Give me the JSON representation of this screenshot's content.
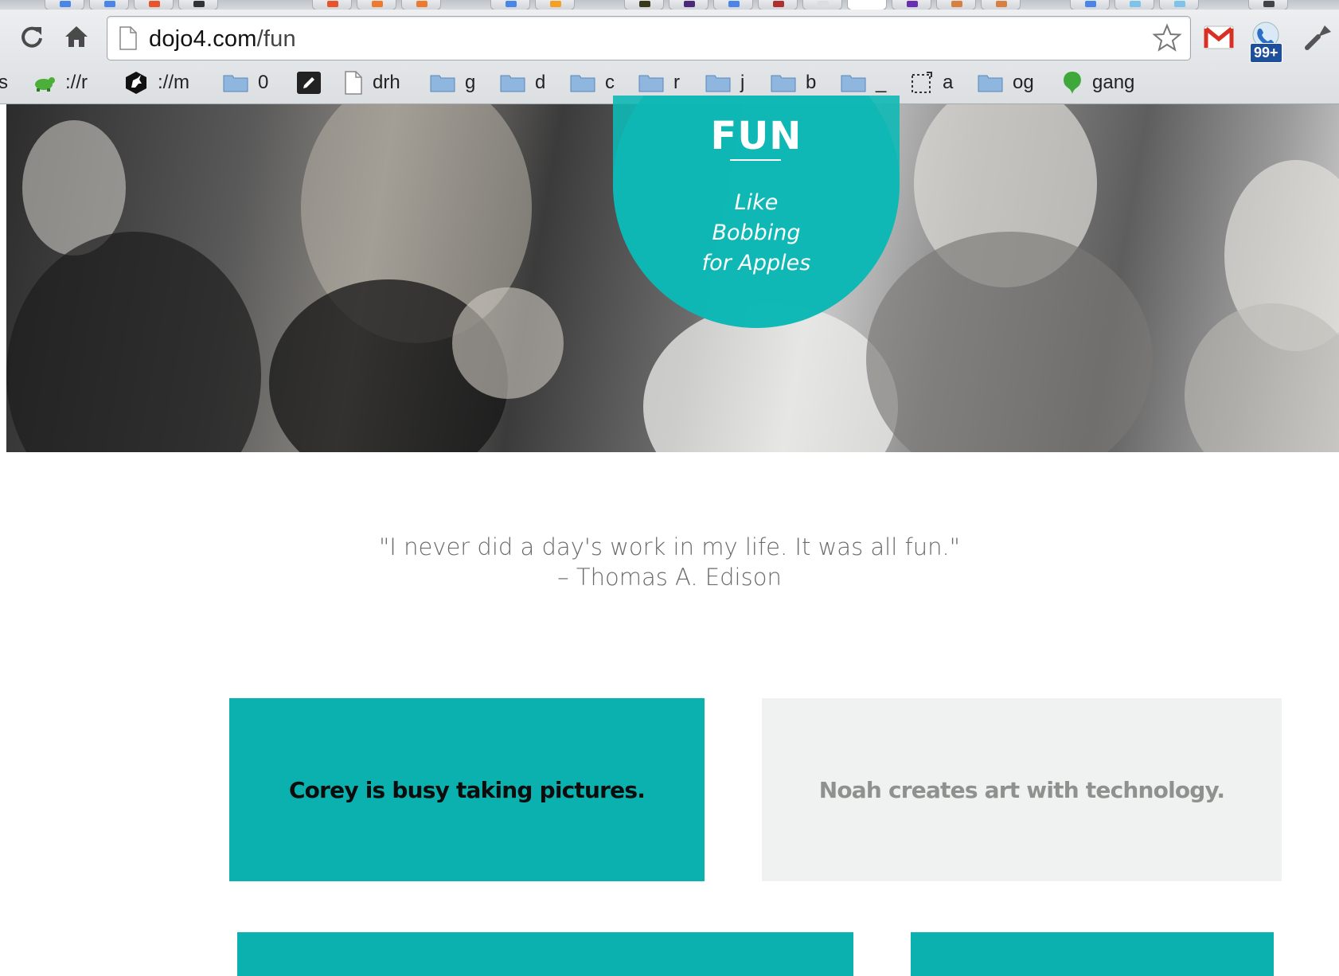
{
  "browser": {
    "url_host": "dojo4.com",
    "url_path": "/fun",
    "notification_badge": "99+",
    "bookmarks": [
      {
        "label": "s",
        "icon": "text-icon"
      },
      {
        "label": "://r",
        "icon": "turtle-icon"
      },
      {
        "label": "://m",
        "icon": "unicorn-icon"
      },
      {
        "label": "0",
        "icon": "folder-icon"
      },
      {
        "label": "",
        "icon": "pencil-icon"
      },
      {
        "label": "drh",
        "icon": "page-icon"
      },
      {
        "label": "g",
        "icon": "folder-icon"
      },
      {
        "label": "d",
        "icon": "folder-icon"
      },
      {
        "label": "c",
        "icon": "folder-icon"
      },
      {
        "label": "r",
        "icon": "folder-icon"
      },
      {
        "label": "j",
        "icon": "folder-icon"
      },
      {
        "label": "b",
        "icon": "folder-icon"
      },
      {
        "label": "_",
        "icon": "folder-icon"
      },
      {
        "label": "a",
        "icon": "dashed-selection-icon"
      },
      {
        "label": "og",
        "icon": "folder-icon"
      },
      {
        "label": "gang",
        "icon": "green-leaf-icon"
      }
    ]
  },
  "hero": {
    "title": "FUN",
    "subtitle_lines": [
      "Like",
      "Bobbing",
      "for Apples"
    ],
    "accent_color": "#0eb8b5"
  },
  "quote": {
    "text": "\"I never did a day's work in my life. It was all fun.\"",
    "attribution": "– Thomas A. Edison"
  },
  "cards": [
    {
      "text": "Corey is busy taking pictures.",
      "style": "teal"
    },
    {
      "text": "Noah creates art with technology.",
      "style": "grey"
    },
    {
      "text": "",
      "style": "teal"
    },
    {
      "text": "",
      "style": "teal"
    }
  ]
}
